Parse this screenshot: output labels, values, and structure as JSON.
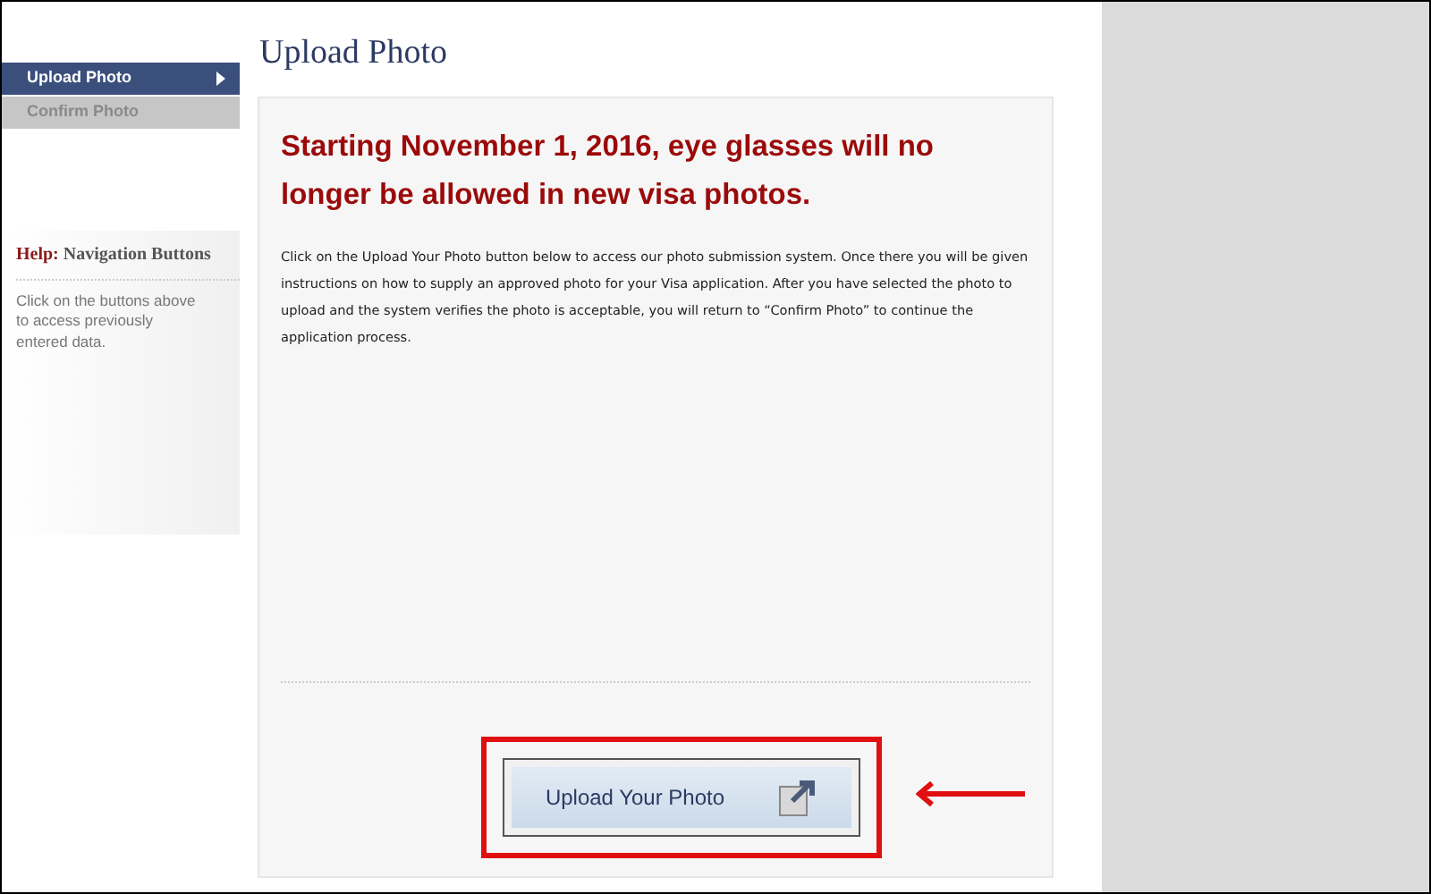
{
  "sidebar": {
    "items": [
      {
        "label": "Upload Photo",
        "selected": true
      },
      {
        "label": "Confirm Photo",
        "selected": false
      }
    ],
    "help": {
      "label": "Help:",
      "title": "Navigation Buttons",
      "text": "Click on the buttons above to access previously entered data."
    }
  },
  "page_title": "Upload Photo",
  "notice": "Starting November 1, 2016, eye glasses will no longer be allowed in new visa photos.",
  "instructions": "Click on the Upload Your Photo button below to access our photo submission system. Once there you will be given instructions on how to supply an approved photo for your Visa application. After you have selected the photo to upload and the system verifies the photo is acceptable, you will return to “Confirm Photo” to continue the application process.",
  "upload_button": {
    "label": "Upload Your Photo"
  }
}
